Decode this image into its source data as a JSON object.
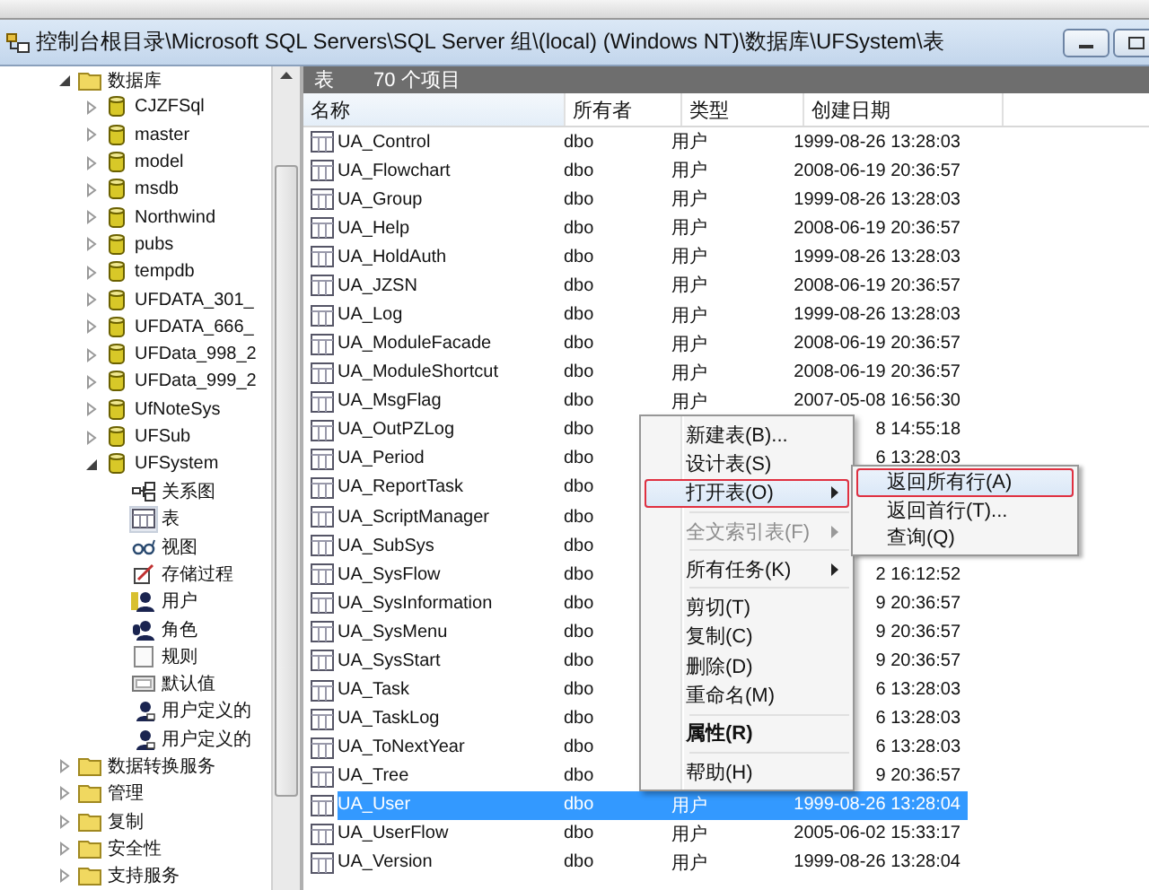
{
  "window": {
    "title": "控制台根目录\\Microsoft SQL Servers\\SQL Server 组\\(local) (Windows NT)\\数据库\\UFSystem\\表"
  },
  "tree": [
    {
      "label": "数据库",
      "kind": "folder",
      "expanded": true,
      "selected": false,
      "children": [
        {
          "label": "CJZFSql",
          "kind": "database",
          "expanded": false,
          "selected": false
        },
        {
          "label": "master",
          "kind": "database",
          "expanded": false,
          "selected": false
        },
        {
          "label": "model",
          "kind": "database",
          "expanded": false,
          "selected": false
        },
        {
          "label": "msdb",
          "kind": "database",
          "expanded": false,
          "selected": false
        },
        {
          "label": "Northwind",
          "kind": "database",
          "expanded": false,
          "selected": false
        },
        {
          "label": "pubs",
          "kind": "database",
          "expanded": false,
          "selected": false
        },
        {
          "label": "tempdb",
          "kind": "database",
          "expanded": false,
          "selected": false
        },
        {
          "label": "UFDATA_301_",
          "kind": "database",
          "expanded": false,
          "selected": false
        },
        {
          "label": "UFDATA_666_",
          "kind": "database",
          "expanded": false,
          "selected": false
        },
        {
          "label": "UFData_998_2",
          "kind": "database",
          "expanded": false,
          "selected": false
        },
        {
          "label": "UFData_999_2",
          "kind": "database",
          "expanded": false,
          "selected": false
        },
        {
          "label": "UfNoteSys",
          "kind": "database",
          "expanded": false,
          "selected": false
        },
        {
          "label": "UFSub",
          "kind": "database",
          "expanded": false,
          "selected": false
        },
        {
          "label": "UFSystem",
          "kind": "database",
          "expanded": true,
          "selected": false,
          "children": [
            {
              "label": "关系图",
              "kind": "diagram",
              "selected": false
            },
            {
              "label": "表",
              "kind": "table",
              "selected": true
            },
            {
              "label": "视图",
              "kind": "view",
              "selected": false
            },
            {
              "label": "存储过程",
              "kind": "procedure",
              "selected": false
            },
            {
              "label": "用户",
              "kind": "user",
              "selected": false
            },
            {
              "label": "角色",
              "kind": "role",
              "selected": false
            },
            {
              "label": "规则",
              "kind": "rule",
              "selected": false
            },
            {
              "label": "默认值",
              "kind": "default",
              "selected": false
            },
            {
              "label": "用户定义的",
              "kind": "udt",
              "selected": false
            },
            {
              "label": "用户定义的",
              "kind": "udt",
              "selected": false
            }
          ]
        }
      ]
    },
    {
      "label": "数据转换服务",
      "kind": "folder",
      "expanded": false,
      "selected": false
    },
    {
      "label": "管理",
      "kind": "folder",
      "expanded": false,
      "selected": false
    },
    {
      "label": "复制",
      "kind": "folder",
      "expanded": false,
      "selected": false
    },
    {
      "label": "安全性",
      "kind": "folder",
      "expanded": false,
      "selected": false
    },
    {
      "label": "支持服务",
      "kind": "folder",
      "expanded": false,
      "selected": false
    }
  ],
  "panel": {
    "title": "表",
    "count": "70 个项目"
  },
  "table": {
    "columns": [
      "名称",
      "所有者",
      "类型",
      "创建日期"
    ],
    "rows": [
      {
        "name": "UA_Control",
        "owner": "dbo",
        "type": "用户",
        "created": "1999-08-26 13:28:03",
        "selected": false
      },
      {
        "name": "UA_Flowchart",
        "owner": "dbo",
        "type": "用户",
        "created": "2008-06-19 20:36:57",
        "selected": false
      },
      {
        "name": "UA_Group",
        "owner": "dbo",
        "type": "用户",
        "created": "1999-08-26 13:28:03",
        "selected": false
      },
      {
        "name": "UA_Help",
        "owner": "dbo",
        "type": "用户",
        "created": "2008-06-19 20:36:57",
        "selected": false
      },
      {
        "name": "UA_HoldAuth",
        "owner": "dbo",
        "type": "用户",
        "created": "1999-08-26 13:28:03",
        "selected": false
      },
      {
        "name": "UA_JZSN",
        "owner": "dbo",
        "type": "用户",
        "created": "2008-06-19 20:36:57",
        "selected": false
      },
      {
        "name": "UA_Log",
        "owner": "dbo",
        "type": "用户",
        "created": "1999-08-26 13:28:03",
        "selected": false
      },
      {
        "name": "UA_ModuleFacade",
        "owner": "dbo",
        "type": "用户",
        "created": "2008-06-19 20:36:57",
        "selected": false
      },
      {
        "name": "UA_ModuleShortcut",
        "owner": "dbo",
        "type": "用户",
        "created": "2008-06-19 20:36:57",
        "selected": false
      },
      {
        "name": "UA_MsgFlag",
        "owner": "dbo",
        "type": "用户",
        "created": "2007-05-08 16:56:30",
        "selected": false
      },
      {
        "name": "UA_OutPZLog",
        "owner": "dbo",
        "created": "8 14:55:18",
        "selected": false
      },
      {
        "name": "UA_Period",
        "owner": "dbo",
        "created": "6 13:28:03",
        "selected": false
      },
      {
        "name": "UA_ReportTask",
        "owner": "dbo",
        "selected": false
      },
      {
        "name": "UA_ScriptManager",
        "owner": "dbo",
        "selected": false
      },
      {
        "name": "UA_SubSys",
        "owner": "dbo",
        "selected": false
      },
      {
        "name": "UA_SysFlow",
        "owner": "dbo",
        "created": "2 16:12:52",
        "selected": false
      },
      {
        "name": "UA_SysInformation",
        "owner": "dbo",
        "created": "9 20:36:57",
        "selected": false
      },
      {
        "name": "UA_SysMenu",
        "owner": "dbo",
        "created": "9 20:36:57",
        "selected": false
      },
      {
        "name": "UA_SysStart",
        "owner": "dbo",
        "created": "9 20:36:57",
        "selected": false
      },
      {
        "name": "UA_Task",
        "owner": "dbo",
        "created": "6 13:28:03",
        "selected": false
      },
      {
        "name": "UA_TaskLog",
        "owner": "dbo",
        "created": "6 13:28:03",
        "selected": false
      },
      {
        "name": "UA_ToNextYear",
        "owner": "dbo",
        "created": "6 13:28:03",
        "selected": false
      },
      {
        "name": "UA_Tree",
        "owner": "dbo",
        "created": "9 20:36:57",
        "selected": false
      },
      {
        "name": "UA_User",
        "owner": "dbo",
        "type": "用户",
        "created": "1999-08-26 13:28:04",
        "selected": true
      },
      {
        "name": "UA_UserFlow",
        "owner": "dbo",
        "type": "用户",
        "created": "2005-06-02 15:33:17",
        "selected": false
      },
      {
        "name": "UA_Version",
        "owner": "dbo",
        "type": "用户",
        "created": "1999-08-26 13:28:04",
        "selected": false
      }
    ]
  },
  "context_menu": {
    "items": [
      {
        "kind": "item",
        "label": "新建表(B)...",
        "selected": false,
        "disabled": false,
        "outlined": false
      },
      {
        "kind": "item",
        "label": "设计表(S)",
        "selected": false,
        "disabled": false,
        "outlined": false
      },
      {
        "kind": "submenu",
        "label": "打开表(O)",
        "selected": true,
        "disabled": false,
        "outlined": true
      },
      {
        "kind": "separator"
      },
      {
        "kind": "submenu",
        "label": "全文索引表(F)",
        "selected": false,
        "disabled": true,
        "outlined": false
      },
      {
        "kind": "separator"
      },
      {
        "kind": "submenu",
        "label": "所有任务(K)",
        "selected": false,
        "disabled": false,
        "outlined": false
      },
      {
        "kind": "separator"
      },
      {
        "kind": "item",
        "label": "剪切(T)",
        "selected": false,
        "disabled": false,
        "outlined": false
      },
      {
        "kind": "item",
        "label": "复制(C)",
        "selected": false,
        "disabled": false,
        "outlined": false
      },
      {
        "kind": "item",
        "label": "删除(D)",
        "selected": false,
        "disabled": false,
        "outlined": false
      },
      {
        "kind": "item",
        "label": "重命名(M)",
        "selected": false,
        "disabled": false,
        "outlined": false
      },
      {
        "kind": "separator"
      },
      {
        "kind": "default",
        "label": "属性(R)",
        "selected": false,
        "disabled": false,
        "outlined": false
      },
      {
        "kind": "separator"
      },
      {
        "kind": "item",
        "label": "帮助(H)",
        "selected": false,
        "disabled": false,
        "outlined": false
      }
    ]
  },
  "submenu": {
    "items": [
      {
        "label": "返回所有行(A)",
        "selected": true,
        "outlined": true
      },
      {
        "label": "返回首行(T)...",
        "selected": false,
        "outlined": false
      },
      {
        "label": "查询(Q)",
        "selected": false,
        "outlined": false
      }
    ]
  }
}
